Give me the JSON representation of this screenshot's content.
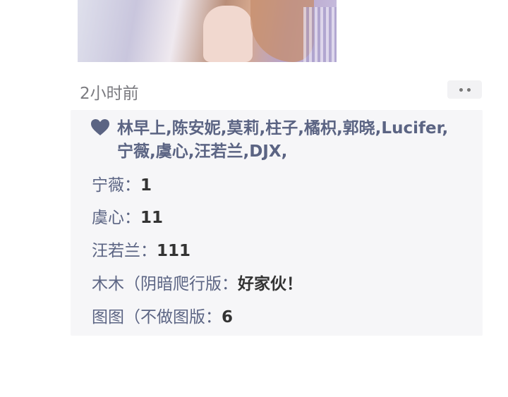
{
  "post": {
    "time": "2小时前"
  },
  "likes": {
    "names": [
      "林早上",
      "陈安妮",
      "莫莉",
      "柱子",
      "橘枳",
      "郭晓",
      "Lucifer",
      "宁薇",
      "虞心",
      "汪若兰",
      "DJX"
    ],
    "text": "林早上,陈安妮,莫莉,柱子,橘枳,郭晓,Lucifer,宁薇,虞心,汪若兰,DJX,"
  },
  "comments": [
    {
      "author": "宁薇",
      "separator": "：",
      "content": "1"
    },
    {
      "author": "虞心",
      "separator": "：",
      "content": "11"
    },
    {
      "author": "汪若兰",
      "separator": "：",
      "content": "111"
    },
    {
      "author": "木木（阴暗爬行版",
      "separator": "：",
      "content": "好家伙！"
    },
    {
      "author": "图图（不做图版",
      "separator": "：",
      "content": "6"
    }
  ],
  "colors": {
    "name_color": "#5b6483",
    "panel_bg": "#f6f6f8",
    "time_color": "#7b7b80"
  }
}
